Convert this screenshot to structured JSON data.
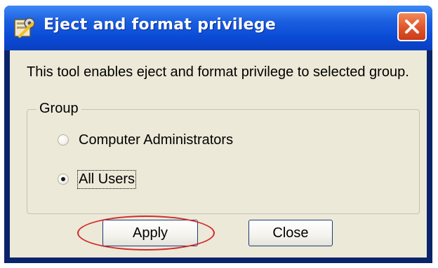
{
  "window": {
    "title": "Eject and format privilege"
  },
  "description": "This tool enables eject and format privilege to selected group.",
  "group": {
    "label": "Group",
    "options": [
      {
        "label": "Computer Administrators",
        "selected": false
      },
      {
        "label": "All Users",
        "selected": true
      }
    ]
  },
  "buttons": {
    "apply": "Apply",
    "close": "Close"
  },
  "colors": {
    "titlebar": "#0a4bd6",
    "client": "#ece9d8",
    "highlight_circle": "#d42a2a",
    "close_button": "#e0542a"
  },
  "icons": {
    "title": "gear-tool-icon",
    "close": "close-icon"
  }
}
